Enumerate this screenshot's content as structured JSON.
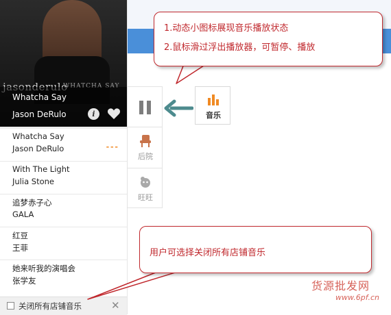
{
  "cover": {
    "artist_logo": "jasonderulo",
    "album_subtitle": "WHATCHA SAY"
  },
  "now_playing": {
    "title": "Whatcha Say",
    "artist": "Jason DeRulo",
    "info_icon": "i",
    "progress": 0.0
  },
  "playlist": [
    {
      "title": "Whatcha Say",
      "artist": "Jason DeRulo",
      "playing": true
    },
    {
      "title": "With The Light",
      "artist": "Julia Stone",
      "playing": false
    },
    {
      "title": "追梦赤子心",
      "artist": "GALA",
      "playing": false
    },
    {
      "title": "红豆",
      "artist": "王菲",
      "playing": false
    },
    {
      "title": "她来听我的演唱会",
      "artist": "张学友",
      "playing": false
    }
  ],
  "footer": {
    "checkbox_label": "关闭所有店铺音乐",
    "checked": false,
    "close_icon": "✕"
  },
  "side_toolbar": {
    "items": [
      {
        "label": "",
        "icon": "pause-icon"
      },
      {
        "label": "后院",
        "icon": "chair-icon"
      },
      {
        "label": "旺旺",
        "icon": "wangwang-icon"
      }
    ]
  },
  "music_button": {
    "label": "音乐",
    "icon": "music-bars-icon"
  },
  "callout_top": {
    "line1": "1.动态小图标展现音乐播放状态",
    "line2": "2.鼠标滑过浮出播放器，可暂停、播放"
  },
  "callout_bottom": {
    "line1": "用户可选择关闭所有店铺音乐"
  },
  "watermark": {
    "text": "货源批发网",
    "url": "www.6pf.cn"
  },
  "colors": {
    "accent": "#f08a24",
    "callout": "#c0282d",
    "arrow": "#4d8b8e",
    "blue_band": "#4a8fd9"
  }
}
